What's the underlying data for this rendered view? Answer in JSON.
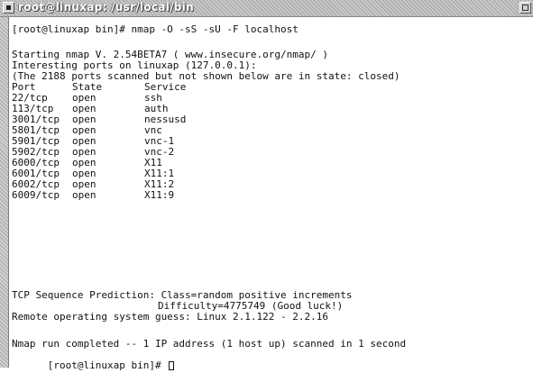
{
  "window": {
    "title": "root@linuxap: /usr/local/bin"
  },
  "terminal": {
    "command_line": "[root@linuxap bin]# nmap -O -sS -sU -F localhost",
    "banner": "Starting nmap V. 2.54BETA7 ( www.insecure.org/nmap/ )",
    "interesting": "Interesting ports on linuxap (127.0.0.1):",
    "closed_note": "(The 2188 ports scanned but not shown below are in state: closed)",
    "port_table": {
      "headers": [
        "Port",
        "State",
        "Service"
      ],
      "rows": [
        [
          "22/tcp",
          "open",
          "ssh"
        ],
        [
          "113/tcp",
          "open",
          "auth"
        ],
        [
          "3001/tcp",
          "open",
          "nessusd"
        ],
        [
          "5801/tcp",
          "open",
          "vnc"
        ],
        [
          "5901/tcp",
          "open",
          "vnc-1"
        ],
        [
          "5902/tcp",
          "open",
          "vnc-2"
        ],
        [
          "6000/tcp",
          "open",
          "X11"
        ],
        [
          "6001/tcp",
          "open",
          "X11:1"
        ],
        [
          "6002/tcp",
          "open",
          "X11:2"
        ],
        [
          "6009/tcp",
          "open",
          "X11:9"
        ]
      ]
    },
    "tcp_seq": "TCP Sequence Prediction: Class=random positive increments",
    "difficulty": "Difficulty=4775749 (Good luck!)",
    "os_guess": "Remote operating system guess: Linux 2.1.122 - 2.2.16",
    "completed": "Nmap run completed -- 1 IP address (1 host up) scanned in 1 second",
    "prompt": "[root@linuxap bin]# "
  },
  "icons": {
    "window_menu": "window-menu-icon",
    "maximize": "maximize-icon",
    "cursor": "text-cursor"
  },
  "colors": {
    "titlebar": "#b8b8b8",
    "terminal_bg": "#ffffff",
    "terminal_fg": "#111111"
  }
}
